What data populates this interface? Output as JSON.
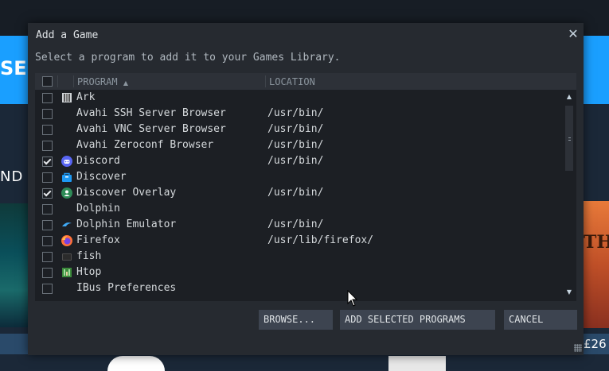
{
  "background": {
    "banner_text": "SES",
    "side_text": "ND",
    "art_right_text": "TH",
    "price": "£26"
  },
  "dialog": {
    "title": "Add a Game",
    "subtitle": "Select a program to add it to your Games Library.",
    "columns": {
      "program": "PROGRAM",
      "location": "LOCATION"
    },
    "rows": [
      {
        "name": "Ark",
        "location": "",
        "checked": false,
        "icon": "ark-icon"
      },
      {
        "name": "Avahi SSH Server Browser",
        "location": "/usr/bin/",
        "checked": false,
        "icon": ""
      },
      {
        "name": "Avahi VNC Server Browser",
        "location": "/usr/bin/",
        "checked": false,
        "icon": ""
      },
      {
        "name": "Avahi Zeroconf Browser",
        "location": "/usr/bin/",
        "checked": false,
        "icon": ""
      },
      {
        "name": "Discord",
        "location": "/usr/bin/",
        "checked": true,
        "icon": "discord-icon"
      },
      {
        "name": "Discover",
        "location": "",
        "checked": false,
        "icon": "discover-icon"
      },
      {
        "name": "Discover Overlay",
        "location": "/usr/bin/",
        "checked": true,
        "icon": "discover-overlay-icon"
      },
      {
        "name": "Dolphin",
        "location": "",
        "checked": false,
        "icon": ""
      },
      {
        "name": "Dolphin Emulator",
        "location": "/usr/bin/",
        "checked": false,
        "icon": "dolphin-emulator-icon"
      },
      {
        "name": "Firefox",
        "location": "/usr/lib/firefox/",
        "checked": false,
        "icon": "firefox-icon"
      },
      {
        "name": "fish",
        "location": "",
        "checked": false,
        "icon": "terminal-icon"
      },
      {
        "name": "Htop",
        "location": "",
        "checked": false,
        "icon": "htop-icon"
      },
      {
        "name": "IBus Preferences",
        "location": "",
        "checked": false,
        "icon": ""
      }
    ],
    "buttons": {
      "browse": "BROWSE...",
      "add": "ADD SELECTED PROGRAMS",
      "cancel": "CANCEL"
    }
  }
}
